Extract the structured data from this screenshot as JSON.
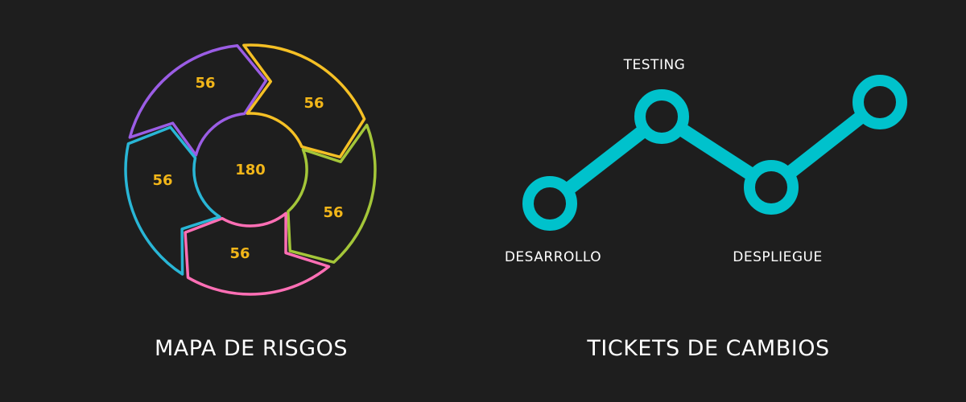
{
  "risk_map": {
    "title": "MAPA DE RISGOS",
    "center_value": "180",
    "segments": [
      {
        "value": "56",
        "color": "#9b5de5"
      },
      {
        "value": "56",
        "color": "#f5c025"
      },
      {
        "value": "56",
        "color": "#a4c639"
      },
      {
        "value": "56",
        "color": "#ff6fb5"
      },
      {
        "value": "56",
        "color": "#29b6d6"
      }
    ]
  },
  "change_tickets": {
    "title": "TICKETS DE CAMBIOS",
    "line_color": "#00c2cc",
    "nodes": [
      {
        "label": "DESARROLLO"
      },
      {
        "label": "TESTING"
      },
      {
        "label": "DESPLIEGUE"
      },
      {
        "label": ""
      }
    ]
  }
}
